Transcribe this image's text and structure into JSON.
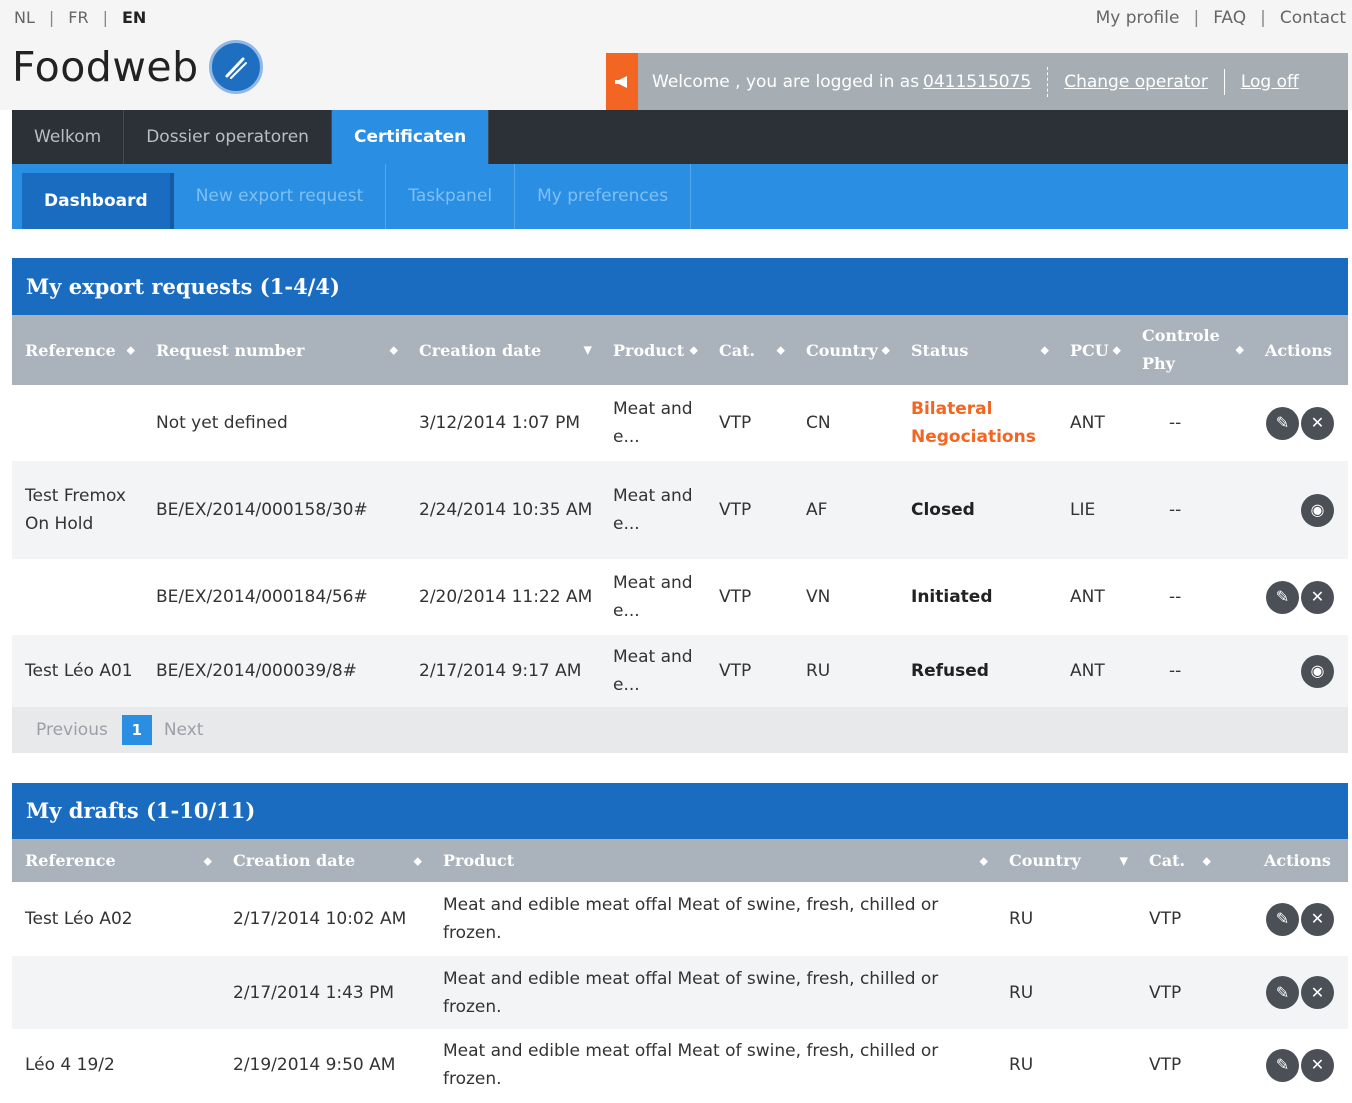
{
  "languages": [
    "NL",
    "FR",
    "EN"
  ],
  "active_language": "EN",
  "top_links": [
    "My profile",
    "FAQ",
    "Contact"
  ],
  "logo": {
    "text": "Foodweb"
  },
  "welcome": {
    "message": "Welcome , you are logged in as",
    "operator": "0411515075",
    "change_operator": "Change operator",
    "log_off": "Log off"
  },
  "main_nav": [
    "Welkom",
    "Dossier operatoren",
    "Certificaten"
  ],
  "main_nav_active": "Certificaten",
  "sub_nav": [
    "Dashboard",
    "New export request",
    "Taskpanel",
    "My preferences"
  ],
  "sub_nav_active": "Dashboard",
  "export_requests": {
    "title": "My export requests (1-4/4)",
    "columns": [
      "Reference",
      "Request number",
      "Creation date",
      "Product",
      "Cat.",
      "Country",
      "Status",
      "PCU",
      "Controle Phy",
      "Actions"
    ],
    "rows": [
      {
        "reference": "",
        "request_number": "Not yet defined",
        "creation_date": "3/12/2014 1:07 PM",
        "product": "Meat and e...",
        "cat": "VTP",
        "country": "CN",
        "status": "Bilateral Negociations",
        "pcu": "ANT",
        "controle": "--",
        "actions": [
          "edit-icon",
          "delete-icon"
        ]
      },
      {
        "reference": "Test Fremox On Hold",
        "request_number": "BE/EX/2014/000158/30#",
        "creation_date": "2/24/2014 10:35 AM",
        "product": "Meat and e...",
        "cat": "VTP",
        "country": "AF",
        "status": "Closed",
        "pcu": "LIE",
        "controle": "--",
        "actions": [
          "view-icon"
        ]
      },
      {
        "reference": "",
        "request_number": "BE/EX/2014/000184/56#",
        "creation_date": "2/20/2014 11:22 AM",
        "product": "Meat and e...",
        "cat": "VTP",
        "country": "VN",
        "status": "Initiated",
        "pcu": "ANT",
        "controle": "--",
        "actions": [
          "edit-icon",
          "delete-icon"
        ]
      },
      {
        "reference": "Test Léo A01",
        "request_number": "BE/EX/2014/000039/8#",
        "creation_date": "2/17/2014 9:17 AM",
        "product": "Meat and e...",
        "cat": "VTP",
        "country": "RU",
        "status": "Refused",
        "pcu": "ANT",
        "controle": "--",
        "actions": [
          "view-icon"
        ]
      }
    ],
    "pager": {
      "previous": "Previous",
      "current": "1",
      "next": "Next"
    }
  },
  "drafts": {
    "title": "My drafts (1-10/11)",
    "columns": [
      "Reference",
      "Creation date",
      "Product",
      "Country",
      "Cat.",
      "Actions"
    ],
    "rows": [
      {
        "reference": "Test Léo A02",
        "creation_date": "2/17/2014 10:02 AM",
        "product": "Meat and edible meat offal Meat of swine, fresh, chilled or frozen.",
        "country": "RU",
        "cat": "VTP"
      },
      {
        "reference": "",
        "creation_date": "2/17/2014 1:43 PM",
        "product": "Meat and edible meat offal Meat of swine, fresh, chilled or frozen.",
        "country": "RU",
        "cat": "VTP"
      },
      {
        "reference": "Léo 4 19/2",
        "creation_date": "2/19/2014 9:50 AM",
        "product": "Meat and edible meat offal Meat of swine, fresh, chilled or frozen.",
        "country": "RU",
        "cat": "VTP"
      }
    ]
  },
  "colors": {
    "brand_blue": "#1a6cc0",
    "nav_blue": "#2a8ee3",
    "alert_orange": "#f26522",
    "header_gray": "#aab3bb"
  }
}
